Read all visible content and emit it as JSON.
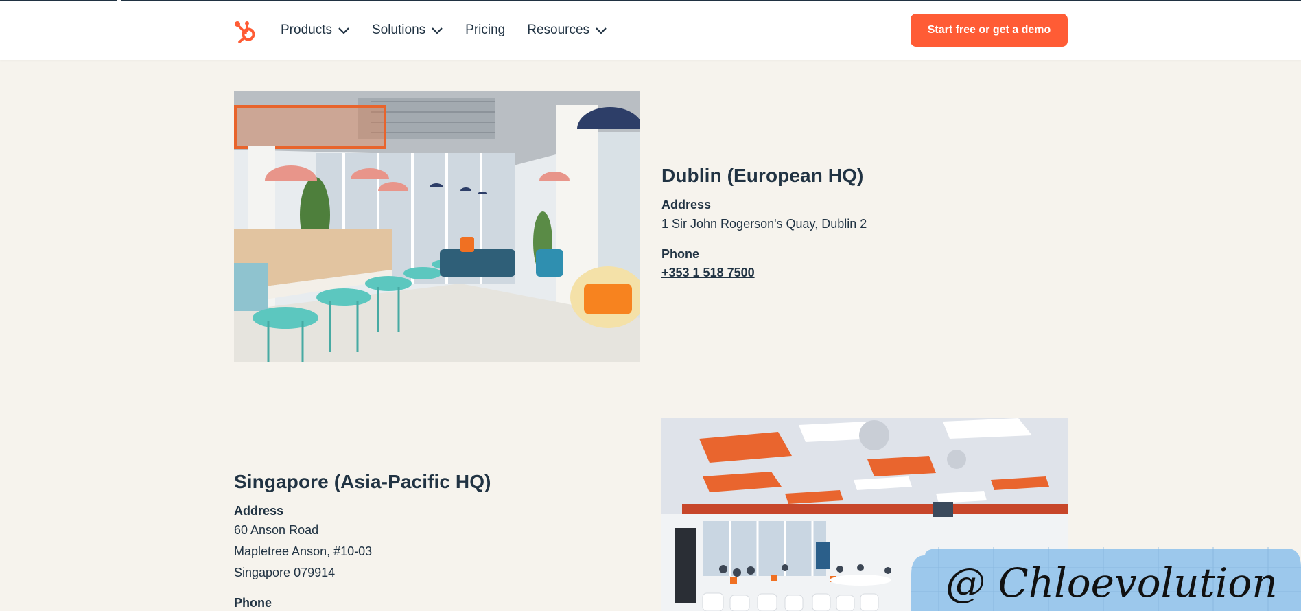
{
  "nav": {
    "logo": "hubspot-sprocket-logo",
    "items": [
      {
        "label": "Products",
        "has_dropdown": true
      },
      {
        "label": "Solutions",
        "has_dropdown": true
      },
      {
        "label": "Pricing",
        "has_dropdown": false
      },
      {
        "label": "Resources",
        "has_dropdown": true
      }
    ],
    "cta_label": "Start free or get a demo"
  },
  "offices": [
    {
      "name": "Dublin (European HQ)",
      "address_label": "Address",
      "address_lines": [
        "1 Sir John Rogerson's Quay, Dublin 2"
      ],
      "phone_label": "Phone",
      "phone": "+353 1 518 7500"
    },
    {
      "name": "Singapore (Asia-Pacific HQ)",
      "address_label": "Address",
      "address_lines": [
        "60 Anson Road",
        "Mapletree Anson, #10-03",
        "Singapore 079914"
      ],
      "phone_label": "Phone"
    }
  ],
  "watermark": "@ Chloevolution",
  "colors": {
    "accent": "#ff5c35",
    "text": "#213343",
    "page_bg": "#f6f3ed",
    "watermark_bg": "#9cc8ec"
  }
}
